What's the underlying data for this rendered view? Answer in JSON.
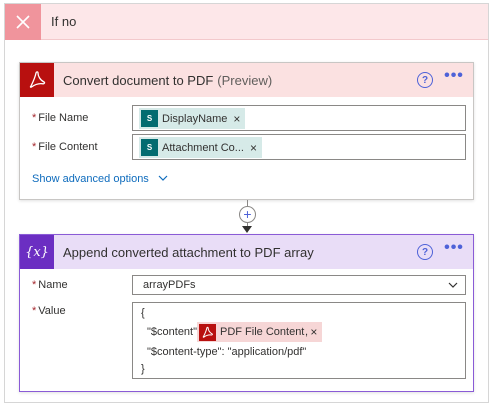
{
  "if_no": {
    "title": "If no"
  },
  "convert_card": {
    "title": "Convert document to PDF",
    "preview": "(Preview)",
    "help": "?",
    "more": "•••",
    "fields": [
      {
        "required": "*",
        "label": "File Name",
        "token": "DisplayName"
      },
      {
        "required": "*",
        "label": "File Content",
        "token": "Attachment Co..."
      }
    ],
    "token_remove": "×",
    "advanced_link": "Show advanced options"
  },
  "connector": {
    "plus": "+"
  },
  "append_card": {
    "icon_text": "{x}",
    "title": "Append converted attachment to PDF array",
    "help": "?",
    "more": "•••",
    "name_label": "Name",
    "name_required": "*",
    "name_value": "arrayPDFs",
    "value_label": "Value",
    "value_required": "*",
    "value_lines": {
      "open": "{",
      "content_key": "\"$content\":",
      "content_token": "PDF File Content",
      "content_comma": ",",
      "type_line": "\"$content-type\": \"application/pdf\"",
      "close": "}"
    },
    "token_remove": "×"
  },
  "colors": {
    "header_red": "#b8100f",
    "header_purple": "#6b2ec2",
    "link_blue": "#0f6cbd",
    "sharepoint_teal": "#036c70"
  }
}
